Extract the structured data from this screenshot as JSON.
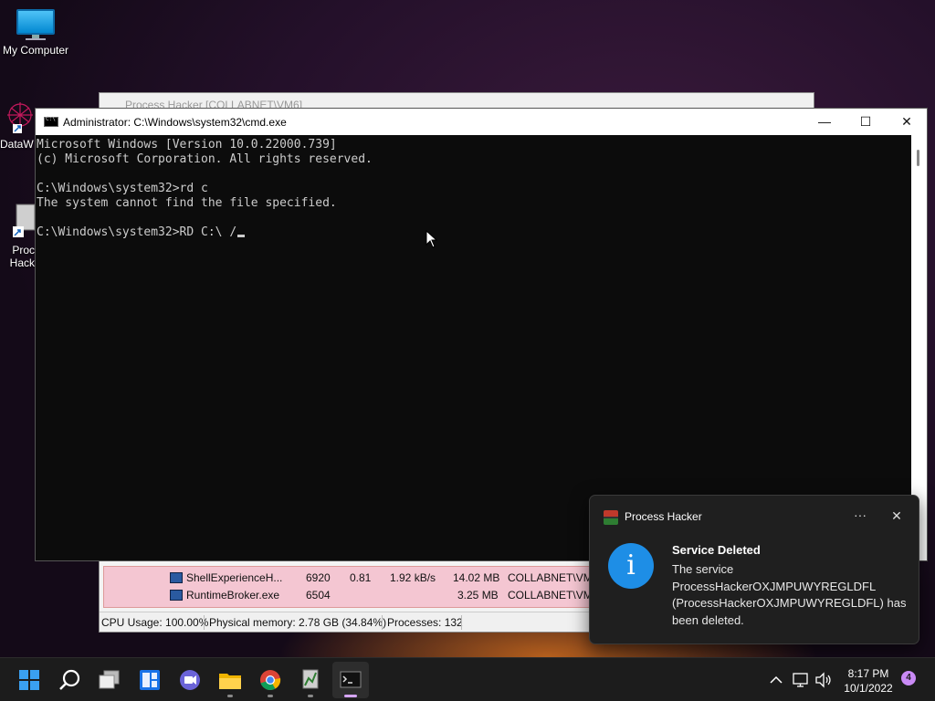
{
  "desktop": {
    "icons": [
      {
        "label": "My Computer"
      },
      {
        "label": "DataW"
      },
      {
        "label": "Proc\nHack"
      }
    ]
  },
  "process_hacker": {
    "title": "Process Hacker [COLLABNET\\VM6]",
    "rows": [
      {
        "name": "ShellExperienceH...",
        "pid": "6920",
        "cpu": "0.81",
        "io": "1.92 kB/s",
        "memory": "14.02 MB",
        "user": "COLLABNET\\VM6"
      },
      {
        "name": "RuntimeBroker.exe",
        "pid": "6504",
        "cpu": "",
        "io": "",
        "memory": "3.25 MB",
        "user": "COLLABNET\\VM6"
      }
    ],
    "status": {
      "cpu": "CPU Usage: 100.00%",
      "memory": "Physical memory: 2.78 GB (34.84%)",
      "processes": "Processes: 132"
    }
  },
  "cmd": {
    "title": "Administrator: C:\\Windows\\system32\\cmd.exe",
    "controls": {
      "minimize": "—",
      "maximize": "☐",
      "close": "✕"
    },
    "lines": [
      "Microsoft Windows [Version 10.0.22000.739]",
      "(c) Microsoft Corporation. All rights reserved.",
      "",
      "C:\\Windows\\system32>rd c",
      "The system cannot find the file specified.",
      "",
      "C:\\Windows\\system32>RD C:\\ /"
    ]
  },
  "notification": {
    "app": "Process Hacker",
    "more": "···",
    "close": "✕",
    "heading": "Service Deleted",
    "message": "The service ProcessHackerOXJMPUWYREGLDFL (ProcessHackerOXJMPUWYREGLDFL) has been deleted."
  },
  "taskbar": {
    "apps": [
      {
        "icon": "windows-start-icon"
      },
      {
        "icon": "search-icon"
      },
      {
        "icon": "task-view-icon"
      },
      {
        "icon": "widgets-icon"
      },
      {
        "icon": "teams-chat-icon"
      },
      {
        "icon": "file-explorer-icon"
      },
      {
        "icon": "chrome-icon"
      },
      {
        "icon": "process-hacker-icon"
      },
      {
        "icon": "cmd-icon"
      }
    ],
    "clock": {
      "time": "8:17 PM",
      "date": "10/1/2022"
    },
    "notification_count": "4"
  },
  "colors": {
    "cmd_bg": "#0c0c0c",
    "cmd_fg": "#cccccc",
    "toast_bg": "#1f1f1f",
    "info_blue": "#1e8ee6",
    "taskbar_bg": "#1c1c1c"
  }
}
